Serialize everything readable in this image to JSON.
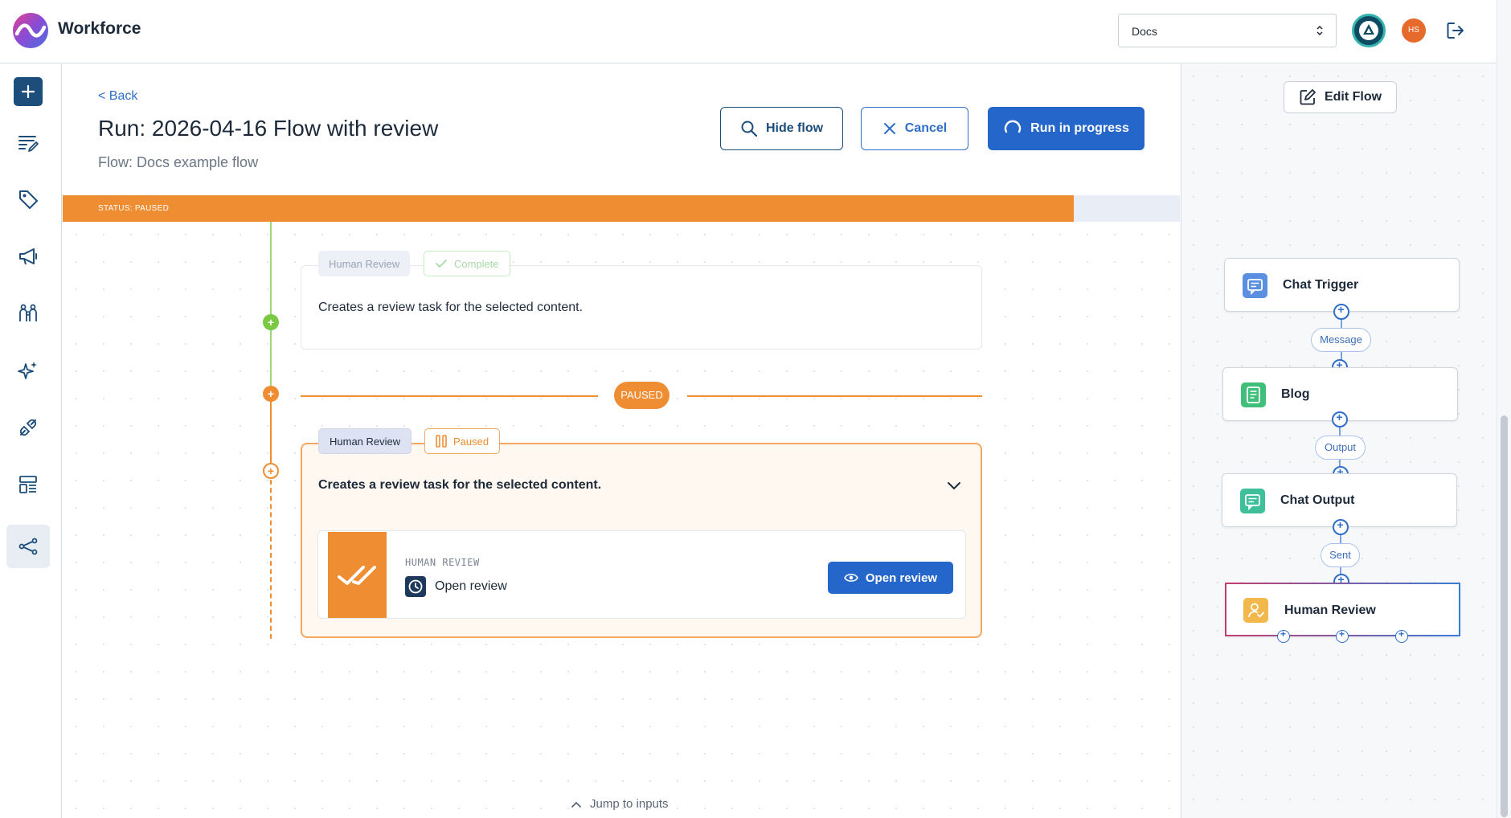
{
  "app": {
    "title": "Workforce"
  },
  "header": {
    "workspace_select_value": "Docs",
    "user_initials": "HS"
  },
  "page": {
    "back_label": "< Back",
    "title": "Run: 2026-04-16 Flow with review",
    "flow_subtitle": "Flow: Docs example flow",
    "buttons": {
      "hide_flow": "Hide flow",
      "cancel": "Cancel",
      "run_in_progress": "Run in progress"
    },
    "status": {
      "label": "STATUS: PAUSED",
      "progress_fraction": 0.905,
      "color": "#ef8d33"
    }
  },
  "timeline": {
    "step1": {
      "tag": "Human Review",
      "state": "Complete",
      "description": "Creates a review task for the selected content."
    },
    "divider_label": "PAUSED",
    "step2": {
      "tag": "Human Review",
      "state": "Paused",
      "description": "Creates a review task for the selected content.",
      "review": {
        "kind": "HUMAN REVIEW",
        "title": "Open review",
        "button": "Open review"
      }
    },
    "jump_label": "Jump to inputs"
  },
  "flow_panel": {
    "edit_label": "Edit Flow",
    "nodes": [
      {
        "label": "Chat Trigger",
        "icon": "chat-icon",
        "color": "#5b8fe0"
      },
      {
        "label": "Blog",
        "icon": "document-icon",
        "color": "#3fbf7a"
      },
      {
        "label": "Chat Output",
        "icon": "chat-icon",
        "color": "#3fbf9a"
      },
      {
        "label": "Human Review",
        "icon": "person-check-icon",
        "color": "#f2b84b"
      }
    ],
    "edges": [
      "Message",
      "Output",
      "Sent"
    ]
  },
  "colors": {
    "accent": "#2466c9",
    "navy": "#1d4d7a",
    "paused": "#ef8d33",
    "complete": "#7ac943"
  }
}
